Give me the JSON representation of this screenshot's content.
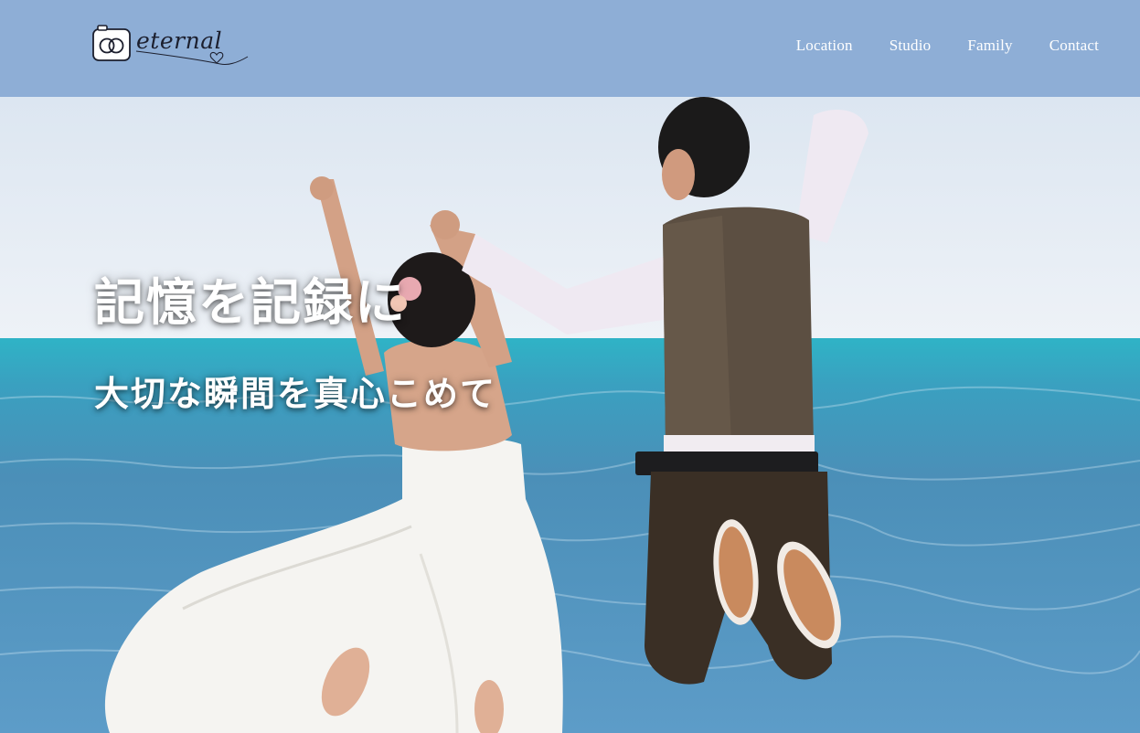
{
  "brand": {
    "logo_text": "eternal",
    "logo_icon": "camera-rings-icon"
  },
  "nav": {
    "items": [
      {
        "label": "Location"
      },
      {
        "label": "Studio"
      },
      {
        "label": "Family"
      },
      {
        "label": "Contact"
      }
    ]
  },
  "hero": {
    "title": "記憶を記録に",
    "subtitle": "大切な瞬間を真心こめて"
  },
  "colors": {
    "header_bg": "#8eaed6",
    "nav_text": "#ffffff",
    "sky": "#e4ecf4",
    "sea": "#4b8fb8",
    "lagoon": "#2fb1c4"
  }
}
